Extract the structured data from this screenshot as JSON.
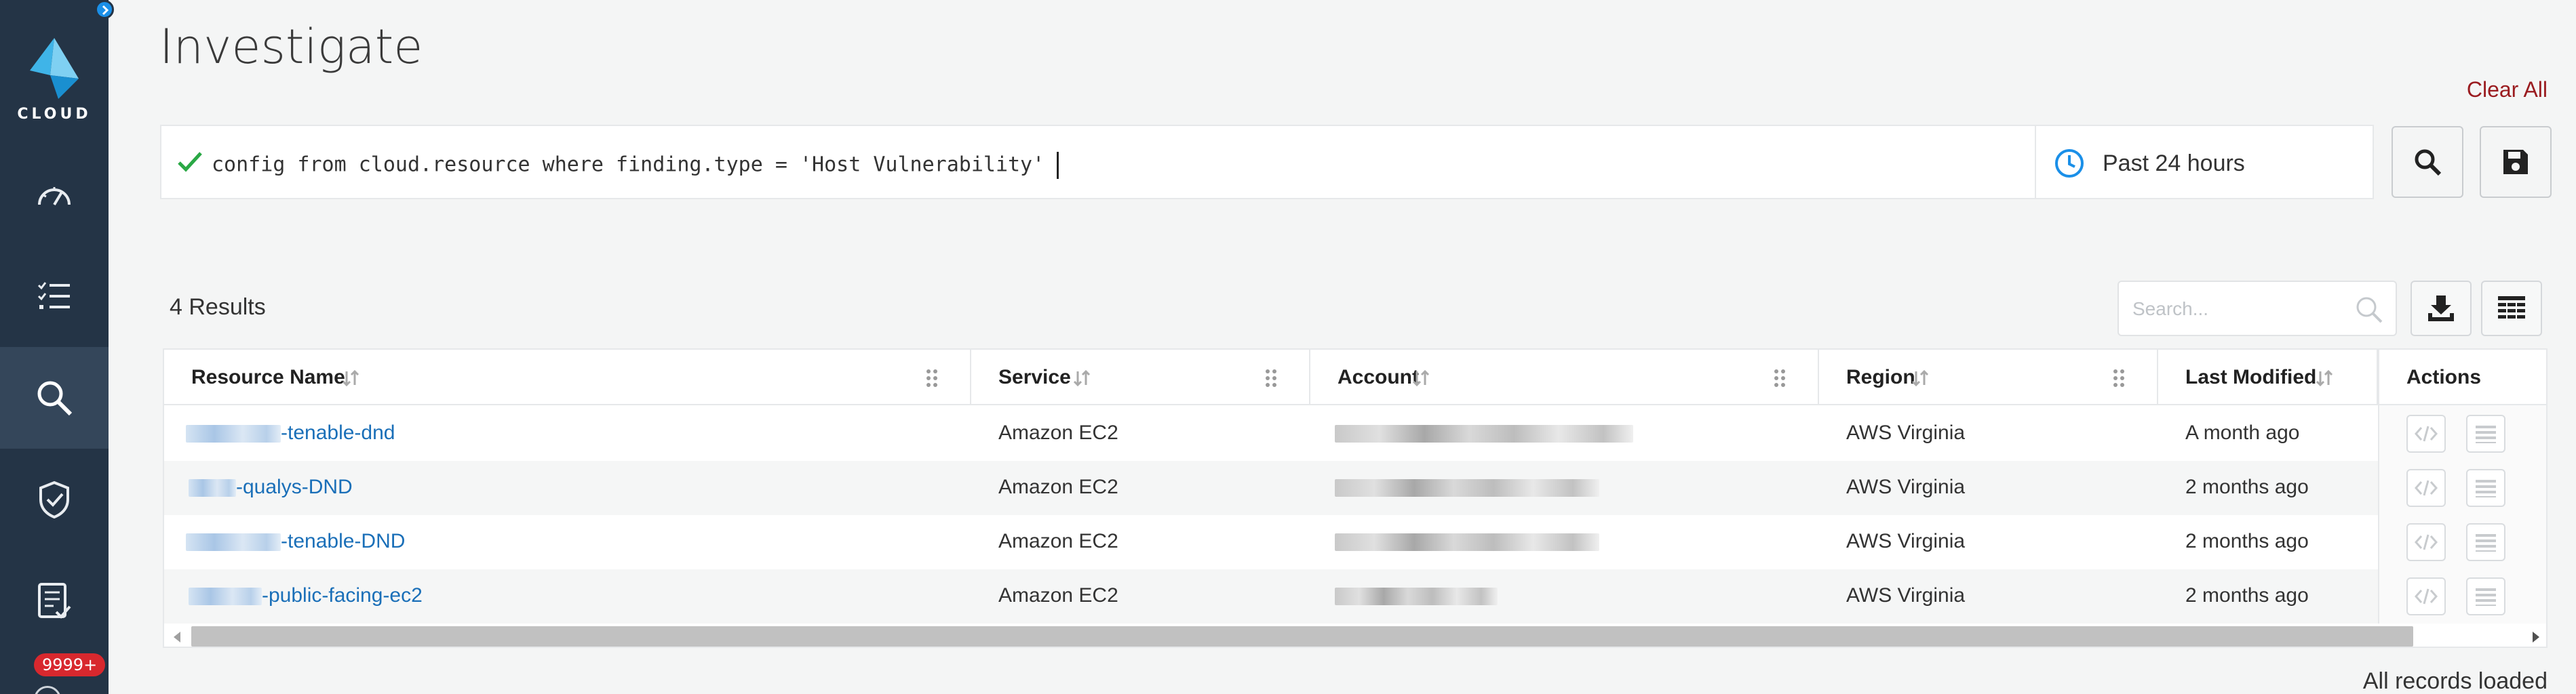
{
  "app": {
    "logo_text": "CLOUD",
    "notification_badge": "9999+",
    "accent_color": "#1a8fe8",
    "sidebar_color": "#243446"
  },
  "page": {
    "title": "Investigate",
    "clear_all": "Clear All"
  },
  "query": {
    "text": "config from cloud.resource where finding.type = 'Host Vulnerability'",
    "status": "valid",
    "time_range": "Past 24 hours"
  },
  "results": {
    "count_label": "4 Results",
    "search_placeholder": "Search...",
    "footer": "All records loaded",
    "columns": [
      "Resource Name",
      "Service",
      "Account",
      "Region",
      "Last Modified",
      "Actions"
    ],
    "rows": [
      {
        "resource_suffix": "-tenable-dnd",
        "service": "Amazon EC2",
        "region": "AWS Virginia",
        "last_modified": "A month ago"
      },
      {
        "resource_suffix": "-qualys-DND",
        "service": "Amazon EC2",
        "region": "AWS Virginia",
        "last_modified": "2 months ago"
      },
      {
        "resource_suffix": "-tenable-DND",
        "service": "Amazon EC2",
        "region": "AWS Virginia",
        "last_modified": "2 months ago"
      },
      {
        "resource_suffix": "-public-facing-ec2",
        "service": "Amazon EC2",
        "region": "AWS Virginia",
        "last_modified": "2 months ago"
      }
    ]
  }
}
